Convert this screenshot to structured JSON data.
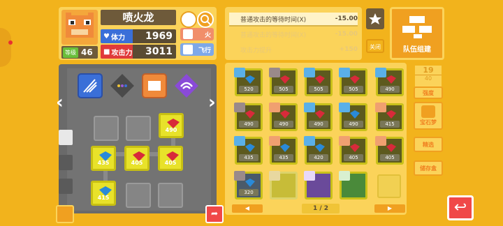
{
  "pokemon": {
    "name": "喷火龙",
    "level_label": "等级",
    "level": "46",
    "hp_label": "体力",
    "hp": "1969",
    "attack_label": "攻击力",
    "attack": "3011",
    "types": [
      {
        "label": "火",
        "color": "#f18e6a"
      },
      {
        "label": "飞行",
        "color": "#7ea8e8"
      }
    ]
  },
  "grid": {
    "cells": [
      {
        "value": "490",
        "active": true
      },
      {
        "value": "435",
        "active": true
      },
      {
        "value": "405",
        "active": true
      },
      {
        "value": "405",
        "active": true
      },
      {
        "value": "415",
        "active": true
      }
    ]
  },
  "effects": {
    "rows": [
      {
        "label": "普通攻击的等待时间(X)",
        "value": "-15.00",
        "active": true
      },
      {
        "label": "普通攻击的等待时间(X)",
        "value": "-15.00",
        "active": false
      },
      {
        "label": "攻击力提升",
        "value": "+150",
        "active": false
      }
    ],
    "auto_label": "关闭",
    "team_label": "队伍组建"
  },
  "stones": {
    "values": [
      "520",
      "505",
      "505",
      "505",
      "490",
      "490",
      "490",
      "490",
      "490",
      "415",
      "435",
      "435",
      "420",
      "405",
      "405",
      "320"
    ],
    "page": "1 / 2",
    "capacity_current": "19",
    "capacity_total": "40",
    "capacity_label": "强度",
    "buttons": [
      "宝石梦",
      "精选",
      "储存盒"
    ]
  },
  "colors": {
    "background": "#f2b31c",
    "panel": "#fbd35a",
    "stone_border": "#c9c119",
    "back": "#f04848"
  }
}
